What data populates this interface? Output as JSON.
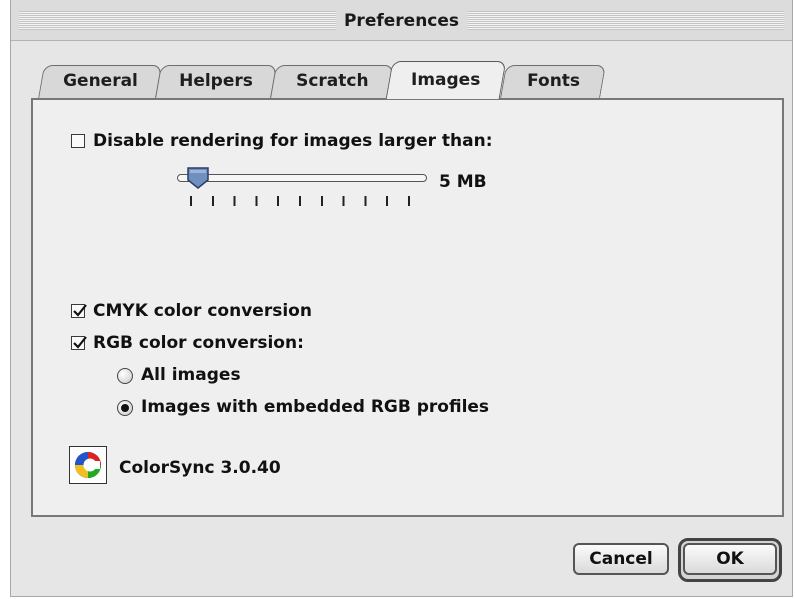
{
  "window": {
    "title": "Preferences"
  },
  "tabs": [
    {
      "label": "General",
      "active": false
    },
    {
      "label": "Helpers",
      "active": false
    },
    {
      "label": "Scratch",
      "active": false
    },
    {
      "label": "Images",
      "active": true
    },
    {
      "label": "Fonts",
      "active": false
    }
  ],
  "images_panel": {
    "disable_rendering": {
      "label": "Disable rendering for images larger than:",
      "checked": false
    },
    "size_slider": {
      "value_label": "5 MB",
      "position_fraction": 0.03,
      "tick_count": 12
    },
    "cmyk_conversion": {
      "label": "CMYK color conversion",
      "checked": true
    },
    "rgb_conversion": {
      "label": "RGB color conversion:",
      "checked": true
    },
    "rgb_options": [
      {
        "label": "All images",
        "selected": false
      },
      {
        "label": "Images with embedded RGB profiles",
        "selected": true
      }
    ],
    "colorsync": {
      "label": "ColorSync 3.0.40",
      "icon": "colorsync-icon"
    }
  },
  "buttons": {
    "cancel": "Cancel",
    "ok": "OK",
    "default": "ok"
  }
}
